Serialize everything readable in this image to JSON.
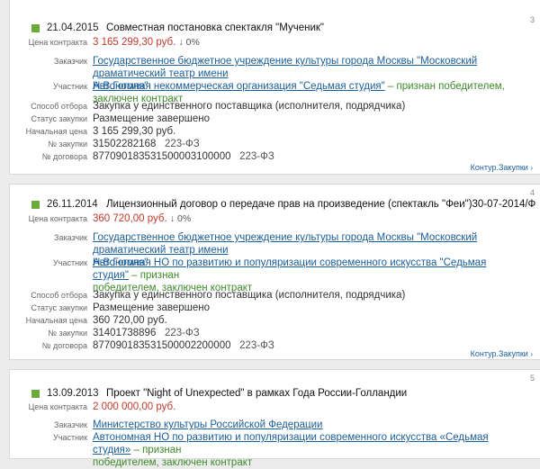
{
  "labels": {
    "price": "Цена контракта",
    "customer": "Заказчик",
    "participant": "Участник",
    "method": "Способ отбора",
    "status": "Статус закупки",
    "start_price": "Начальная цена",
    "purchase_no": "№ закупки",
    "contract_no": "№ договора"
  },
  "cards": [
    {
      "num": "3",
      "date": "21.04.2015",
      "title": "Совместная постановка спектакля \"Мученик\"",
      "price": "3 165 299,30 руб.",
      "delta": "↓ 0%",
      "customer_line1": "Государственное бюджетное учреждение культуры города Москвы \"Московский драматический театр имени",
      "customer_line2": "Н.В.Гоголя\"",
      "participant": "Автономная некоммерческая организация \"Седьмая студия\"",
      "participant_status": "– признан победителем, заключен контракт",
      "method": "Закупка у единственного поставщика (исполнителя, подрядчика)",
      "status": "Размещение завершено",
      "start_price": "3 165 299,30 руб.",
      "purchase_no": "31502282168",
      "purchase_law": "223-ФЗ",
      "contract_no": "877090183531500003100000",
      "contract_law": "223-ФЗ",
      "footer_link": "Контур.Закупки"
    },
    {
      "num": "4",
      "date": "26.11.2014",
      "title": "Лицензионный договор о передаче прав на произведение (спектакль \"Феи\")30-07-2014/Ф",
      "price": "360 720,00 руб.",
      "delta": "↓ 0%",
      "customer_line1": "Государственное бюджетное учреждение культуры города Москвы \"Московский драматический театр имени",
      "customer_line2": "Н.В.Гоголя\"",
      "participant_line1": "Автономная НО по развитию и популяризации современного искусства \"Седьмая студия\"",
      "participant_status_line1": "– признан",
      "participant_status_line2": "победителем, заключен контракт",
      "method": "Закупка у единственного поставщика (исполнителя, подрядчика)",
      "status": "Размещение завершено",
      "start_price": "360 720,00 руб.",
      "purchase_no": "31401738896",
      "purchase_law": "223-ФЗ",
      "contract_no": "877090183531500002200000",
      "contract_law": "223-ФЗ",
      "footer_link": "Контур.Закупки"
    },
    {
      "num": "5",
      "date": "13.09.2013",
      "title": "Проект \"Night of Unexpected\" в рамках Года России-Голландии",
      "price": "2 000 000,00 руб.",
      "customer": "Министерство культуры Российской Федерации",
      "participant_line1": "Автономная НО по развитию и популяризации современного искусства «Седьмая студия»",
      "participant_status_line1": "– признан",
      "participant_status_line2": "победителем, заключен контракт"
    }
  ]
}
